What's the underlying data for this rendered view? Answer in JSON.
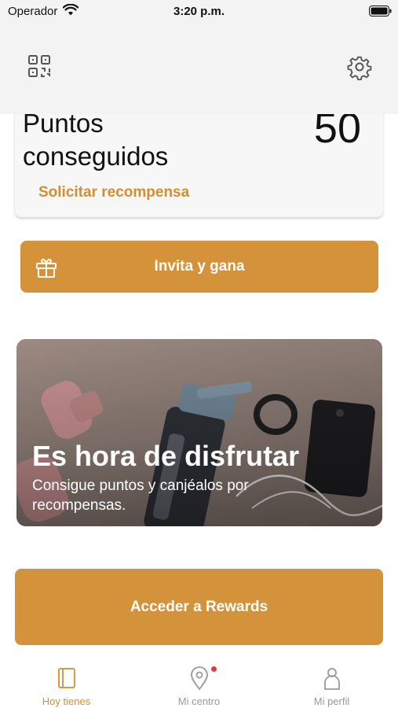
{
  "status_bar": {
    "carrier": "Operador",
    "time": "3:20 p.m."
  },
  "header": {
    "qr_icon": "qr-code-icon",
    "settings_icon": "gear-icon"
  },
  "points_card": {
    "title": "Puntos conseguidos",
    "value": "50",
    "redeem_link": "Solicitar recompensa"
  },
  "invite": {
    "label": "Invita y gana",
    "icon": "gift-icon"
  },
  "promo": {
    "title": "Es hora de disfrutar",
    "text": "Consigue puntos y canjéalos por recompensas."
  },
  "rewards": {
    "label": "Acceder a Rewards"
  },
  "tabs": [
    {
      "label": "Hoy tienes",
      "icon": "book-icon",
      "active": true
    },
    {
      "label": "Mi centro",
      "icon": "location-pin-icon",
      "active": false,
      "has_notification": true
    },
    {
      "label": "Mi perfil",
      "icon": "person-icon",
      "active": false
    }
  ],
  "colors": {
    "accent": "#d4933a",
    "accent_text": "#d18f34",
    "header_bg": "#f3f3f3",
    "notification_dot": "#e53935",
    "tab_inactive": "#9a9a9a"
  }
}
